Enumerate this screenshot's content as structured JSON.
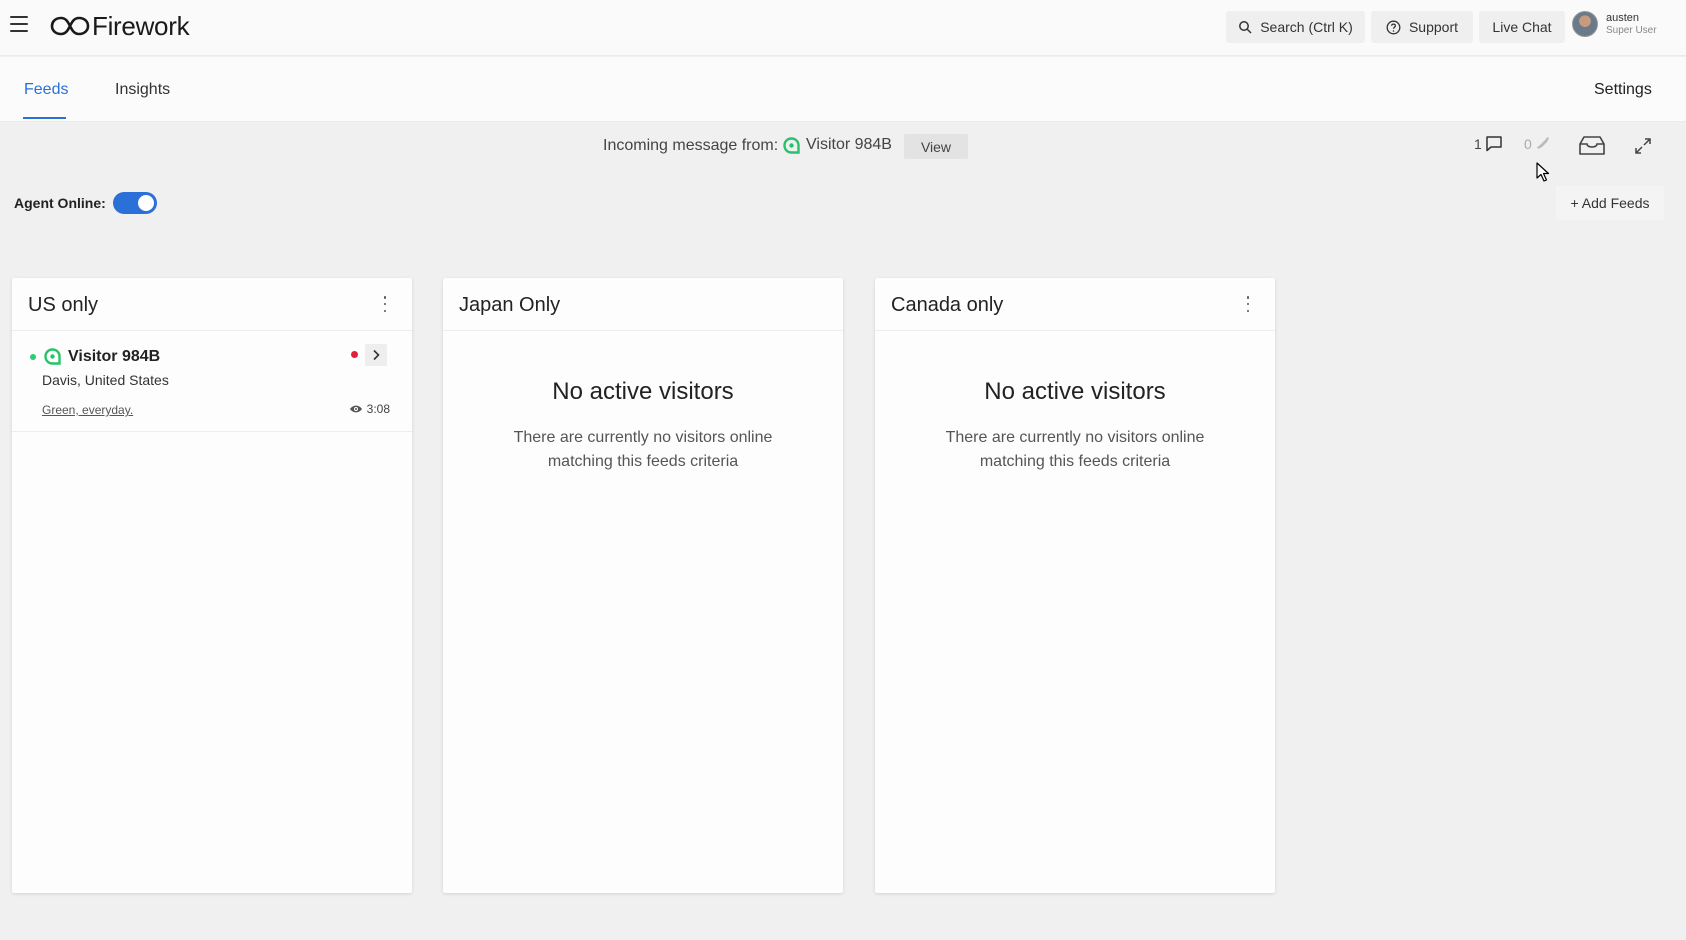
{
  "app": {
    "name": "Firework"
  },
  "header": {
    "search_label": "Search (Ctrl K)",
    "support_label": "Support",
    "live_chat_label": "Live Chat",
    "user": {
      "name": "austen",
      "role": "Super User"
    }
  },
  "tabs": [
    {
      "label": "Feeds",
      "active": true
    },
    {
      "label": "Insights",
      "active": false
    }
  ],
  "settings_label": "Settings",
  "message_bar": {
    "text": "Incoming message from:",
    "visitor": "Visitor 984B",
    "view_label": "View",
    "chat_count": "1",
    "call_count": "0"
  },
  "agent": {
    "label": "Agent Online:",
    "online": true
  },
  "add_feeds_label": "+ Add Feeds",
  "feeds": [
    {
      "title": "US only",
      "visitors": [
        {
          "name": "Visitor 984B",
          "location": "Davis, United States",
          "page": "Green, everyday.",
          "time": "3:08"
        }
      ]
    },
    {
      "title": "Japan Only",
      "empty_title": "No active visitors",
      "empty_desc": "There are currently no visitors online matching this feeds criteria"
    },
    {
      "title": "Canada only",
      "empty_title": "No active visitors",
      "empty_desc": "There are currently no visitors online matching this feeds criteria"
    }
  ],
  "colors": {
    "accent": "#2a70d8",
    "online": "#2ecc71",
    "alert": "#e0213a",
    "visitor_icon": "#27c26a"
  }
}
